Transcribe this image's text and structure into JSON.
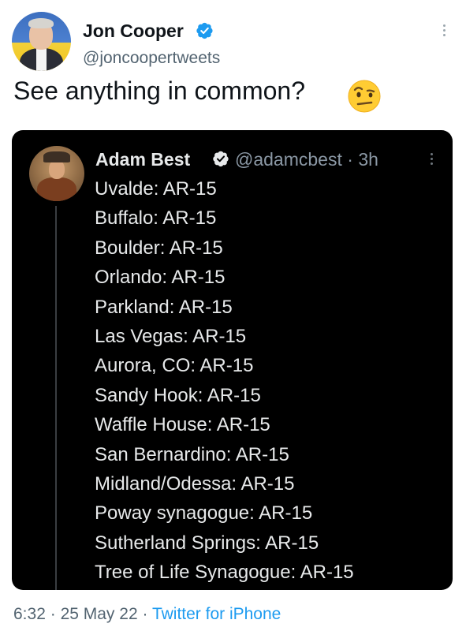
{
  "author": {
    "display_name": "Jon Cooper",
    "handle": "@joncoopertweets",
    "verified": true
  },
  "tweet": {
    "text": "See anything in common?",
    "emoji": "face-with-raised-eyebrow"
  },
  "quoted_tweet": {
    "display_name": "Adam Best",
    "handle": "@adamcbest",
    "separator": "·",
    "time": "3h",
    "verified": true,
    "lines": [
      "Uvalde: AR-15",
      "Buffalo: AR-15",
      "Boulder: AR-15",
      "Orlando: AR-15",
      "Parkland: AR-15",
      "Las Vegas: AR-15",
      "Aurora, CO: AR-15",
      "Sandy Hook: AR-15",
      "Waffle House: AR-15",
      "San Bernardino: AR-15",
      "Midland/Odessa: AR-15",
      "Poway synagogue: AR-15",
      "Sutherland Springs: AR-15",
      "Tree of Life Synagogue: AR-15"
    ]
  },
  "meta": {
    "time": "6:32",
    "separator": "·",
    "date": "25 May 22",
    "source": "Twitter for iPhone"
  },
  "colors": {
    "verified_badge": "#1d9bf0",
    "secondary_text": "#536471",
    "link": "#1d9bf0",
    "quote_background": "#000000"
  }
}
